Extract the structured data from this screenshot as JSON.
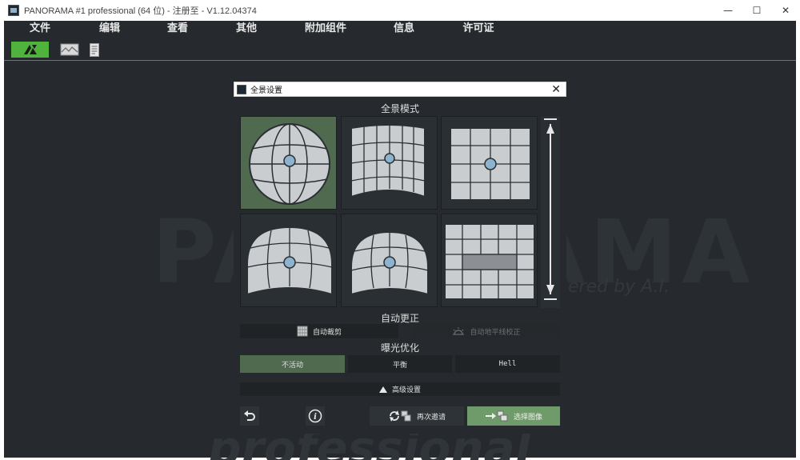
{
  "window": {
    "title": "PANORAMA #1 professional (64 位) - 注册至 - V1.12.04374",
    "controls": [
      "—",
      "☐",
      "✕"
    ]
  },
  "menu": {
    "items": [
      "文件",
      "编辑",
      "查看",
      "其他",
      "附加组件",
      "信息",
      "许可证"
    ]
  },
  "watermark": {
    "big": "PANORAMA",
    "sub": "ered by A.I.",
    "pro": "professional"
  },
  "dialog": {
    "title": "全景设置",
    "close": "✕",
    "mode_label": "全景模式",
    "auto_label": "自动更正",
    "auto_crop": "自动裁剪",
    "auto_horizon": "自动地平线校正",
    "exposure_label": "曝光优化",
    "exposure_options": [
      "不活动",
      "平衡",
      "Hell"
    ],
    "advanced": "高级设置",
    "retry": "再次邀请",
    "select_images": "选择图像",
    "selected_mode": 0
  },
  "colors": {
    "accent_green": "#4fb33d",
    "active_tile": "#4f6a4e",
    "bright_button": "#6f9a6a",
    "background": "#262a2e"
  }
}
